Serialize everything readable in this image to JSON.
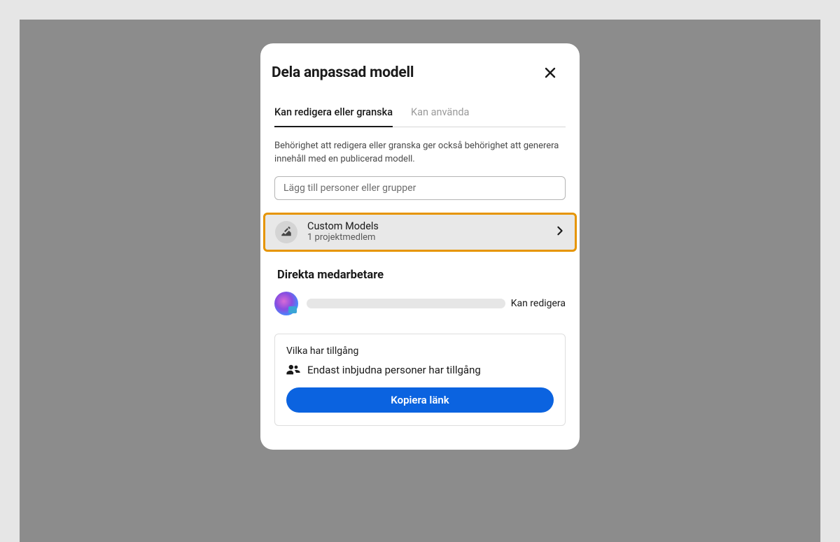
{
  "modal": {
    "title": "Dela anpassad modell",
    "tabs": {
      "edit_review": "Kan redigera eller granska",
      "can_use": "Kan använda"
    },
    "description": "Behörighet att redigera eller granska ger också behörighet att generera innehåll med en publicerad modell.",
    "add_placeholder": "Lägg till personer eller grupper",
    "project": {
      "name": "Custom Models",
      "members": "1 projektmedlem"
    },
    "collaborators": {
      "section_title": "Direkta medarbetare",
      "items": [
        {
          "role": "Kan redigera"
        }
      ]
    },
    "access": {
      "title": "Vilka har tillgång",
      "description": "Endast inbjudna personer har tillgång",
      "copy_button": "Kopiera länk"
    }
  }
}
